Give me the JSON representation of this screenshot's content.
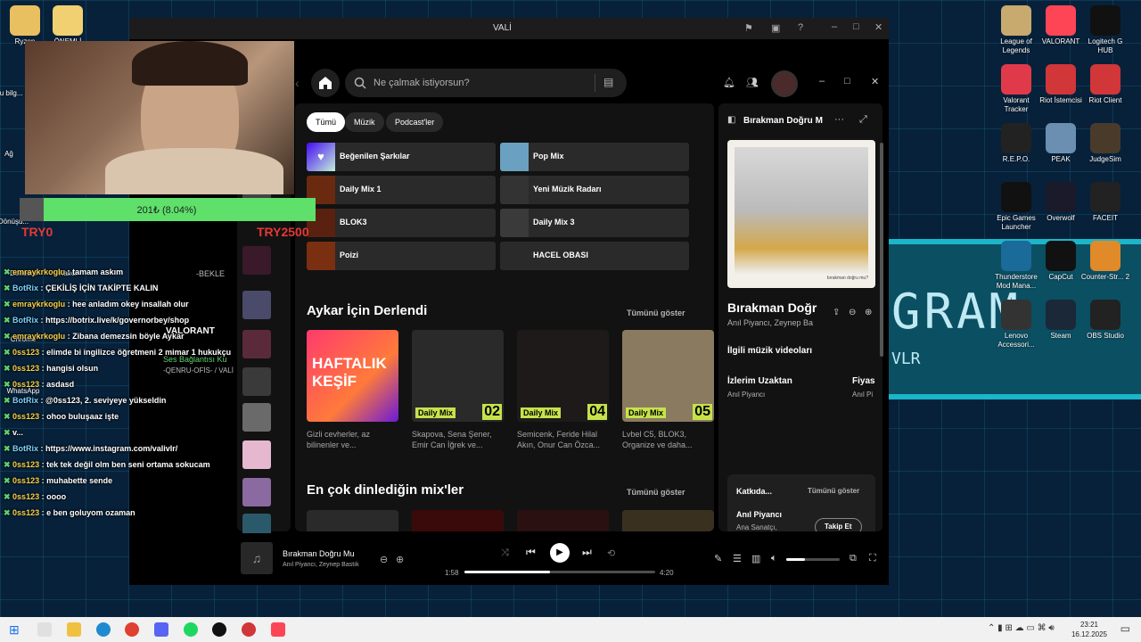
{
  "desktop_left": [
    {
      "label": "Ryzen"
    },
    {
      "label": "ÖNEMLİ"
    },
    {
      "label": "Bu bilg..."
    },
    {
      "label": "Ağ"
    },
    {
      "label": "Dönüşü..."
    },
    {
      "label": "Chrome"
    },
    {
      "label": "Denetim"
    },
    {
      "label": "Kalıcı"
    },
    {
      "label": "WhatsApp"
    }
  ],
  "desktop_right": [
    {
      "label": "League of Legends",
      "color": "#c8aa6e"
    },
    {
      "label": "VALORANT",
      "color": "#fd4556"
    },
    {
      "label": "Logitech G HUB",
      "color": "#111"
    },
    {
      "label": "Valorant Tracker",
      "color": "#e03a4a"
    },
    {
      "label": "Riot İstemcisi",
      "color": "#d13639"
    },
    {
      "label": "Riot Client",
      "color": "#d13639"
    },
    {
      "label": "R.E.P.O.",
      "color": "#222"
    },
    {
      "label": "PEAK",
      "color": "#6a8fb0"
    },
    {
      "label": "JudgeSim",
      "color": "#4a3a2a"
    },
    {
      "label": "Epic Games Launcher",
      "color": "#111"
    },
    {
      "label": "Overwolf",
      "color": "#1a1a2a"
    },
    {
      "label": "FACEIT",
      "color": "#222"
    },
    {
      "label": "Thunderstore Mod Mana...",
      "color": "#1a6a9a"
    },
    {
      "label": "CapCut",
      "color": "#111"
    },
    {
      "label": "Counter-Str... 2",
      "color": "#e08a2a"
    },
    {
      "label": "Lenovo Accessori...",
      "color": "#333"
    },
    {
      "label": "Steam",
      "color": "#1b2838"
    },
    {
      "label": "OBS Studio",
      "color": "#222"
    }
  ],
  "bg_text": {
    "big": "GRAM",
    "small": "VLR"
  },
  "window_title": "VALİ",
  "search": {
    "placeholder": "Ne çalmak istiyorsun?"
  },
  "chips": [
    "Tümü",
    "Müzik",
    "Podcast'ler"
  ],
  "tiles": [
    {
      "label": "Beğenilen Şarkılar",
      "color": "#5a2ed1"
    },
    {
      "label": "Pop Mix",
      "color": "#6aa0c0"
    },
    {
      "label": "Daily Mix 1",
      "color": "#6a2a10"
    },
    {
      "label": "Yeni Müzik Radarı",
      "color": "#333"
    },
    {
      "label": "BLOK3",
      "color": "#5a2010"
    },
    {
      "label": "Daily Mix 3",
      "color": "#3a3a3a"
    },
    {
      "label": "Poizi",
      "color": "#7a3010"
    },
    {
      "label": "HACEL OBASI",
      "color": "#2a2a2a"
    }
  ],
  "section1": {
    "title": "Aykar İçin Derlendi",
    "show_all": "Tümünü göster"
  },
  "cards": [
    {
      "badge": "",
      "num": "",
      "title_art": "HAFTALIK KEŞİF",
      "desc": "Gizli cevherler, az bilinenler ve..."
    },
    {
      "badge": "Daily Mix",
      "num": "02",
      "title_art": "",
      "desc": "Skapova, Sena Şener, Emir Can İğrek ve..."
    },
    {
      "badge": "Daily Mix",
      "num": "04",
      "title_art": "",
      "desc": "Semicenk, Feride Hilal Akın, Onur Can Özca..."
    },
    {
      "badge": "Daily Mix",
      "num": "05",
      "title_art": "",
      "desc": "Lvbel C5, BLOK3, Organize ve daha..."
    }
  ],
  "section2": {
    "title": "En çok dinlediğin mix'ler",
    "show_all": "Tümünü göster"
  },
  "right_panel": {
    "header": "Bırakman Doğru M",
    "art_caption": "bırakman doğru mu?",
    "title": "Bırakman Doğr",
    "artists": "Anıl Piyancı, Zeynep Ba",
    "videos_label": "İlgili müzik videoları",
    "video1": "İzlerim Uzaktan",
    "video1_artist": "Anıl Piyancı",
    "video2": "Fiyas",
    "video2_artist": "Anıl Pi",
    "credits": "Katkıda...",
    "credits_show_all": "Tümünü göster",
    "credit_name": "Anıl Piyancı",
    "credit_role": "Ana Sanatçı,",
    "follow": "Takip Et"
  },
  "player": {
    "title": "Bırakman Doğru Mu",
    "artists": "Anıl Piyancı, Zeynep Bastık",
    "elapsed": "1:58",
    "duration": "4:20",
    "progress": 0.45,
    "volume": 0.35
  },
  "overlay": {
    "progress_text": "201₺ (8.04%)",
    "progress_value": 0.0804,
    "try_left": "TRY0",
    "try_right": "TRY2500"
  },
  "discord": {
    "status": "Ses Bağlantısı Ku",
    "channel": "-QENRU-OFİS- / VALİ",
    "game": "VALORANT",
    "waiting": "-BEKLE"
  },
  "chat": [
    {
      "user": "emraykrkoglu",
      "text": "tamam askım",
      "bot": false
    },
    {
      "user": "BotRix",
      "text": "ÇEKİLİŞ İÇİN TAKİPTE KALIN",
      "bot": true
    },
    {
      "user": "emraykrkoglu",
      "text": "hee anladım okey insallah olur",
      "bot": false
    },
    {
      "user": "BotRix",
      "text": "https://botrix.live/k/governorbey/shop",
      "bot": true
    },
    {
      "user": "emraykrkoglu",
      "text": "Zibana demezsin böyle Aykar",
      "bot": false
    },
    {
      "user": "0ss123",
      "text": "elimde bi ingilizce öğretmeni 2 mimar 1 hukukçu",
      "bot": false
    },
    {
      "user": "0ss123",
      "text": "hangisi olsun",
      "bot": false
    },
    {
      "user": "0ss123",
      "text": "asdasd",
      "bot": false
    },
    {
      "user": "BotRix",
      "text": "@0ss123, 2. seviyeye yükseldin",
      "bot": true
    },
    {
      "user": "0ss123",
      "text": "ohoo buluşaaz işte",
      "bot": false
    },
    {
      "user": "",
      "text": "v...",
      "bot": false
    },
    {
      "user": "BotRix",
      "text": "https://www.instagram.com/valivlr/",
      "bot": true
    },
    {
      "user": "0ss123",
      "text": "tek tek değil olm ben seni ortama sokucam",
      "bot": false
    },
    {
      "user": "0ss123",
      "text": "muhabette sende",
      "bot": false
    },
    {
      "user": "0ss123",
      "text": "oooo",
      "bot": false
    },
    {
      "user": "0ss123",
      "text": "e ben goluyom ozaman",
      "bot": false
    }
  ],
  "clock": {
    "time": "23:21",
    "date": "16.12.2025"
  }
}
